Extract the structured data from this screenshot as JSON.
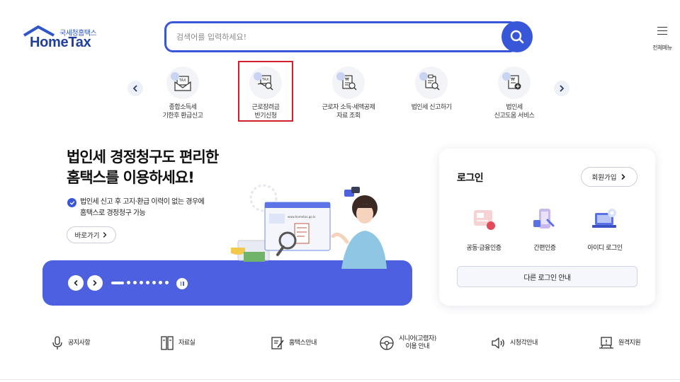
{
  "header": {
    "logo_sub": "국세청홈택스",
    "logo_main": "HomeTax",
    "search_placeholder": "검색어를 입력하세요!",
    "all_menu_label": "전체메뉴"
  },
  "quick_menu": {
    "items": [
      {
        "label": "종합소득세\n기한후 환급신고",
        "icon": "tax-envelope-icon"
      },
      {
        "label": "근로장려금\n반기신청",
        "icon": "tax-hand-search-icon",
        "highlighted": true
      },
      {
        "label": "근로자 소득·세액공제\n자료 조회",
        "icon": "receipt-search-icon"
      },
      {
        "label": "법인세 신고하기",
        "icon": "document-search-icon"
      },
      {
        "label": "법인세\n신고도움 서비스",
        "icon": "tax-document-plus-icon"
      }
    ]
  },
  "banner": {
    "title": "법인세 경정청구도 편리한\n홈택스를 이용하세요!",
    "description": "법인세 신고 후 고지·환급 이력이 없는 경우에\n홈택스로 경정청구 가능",
    "go_button": "바로가기",
    "illustration_url_text": "www.hometax.go.kr",
    "pager_count": 8
  },
  "login": {
    "title": "로그인",
    "join_button": "회원가입",
    "options": [
      {
        "label": "공동·금융인증",
        "icon": "certificate-icon"
      },
      {
        "label": "간편인증",
        "icon": "mobile-auth-icon"
      },
      {
        "label": "아이디 로그인",
        "icon": "laptop-id-icon"
      }
    ],
    "other_login": "다른 로그인 안내"
  },
  "bottom_menu": [
    {
      "label": "공지사항",
      "icon": "microphone-icon"
    },
    {
      "label": "자료실",
      "icon": "archive-icon"
    },
    {
      "label": "홈택스안내",
      "icon": "edit-note-icon"
    },
    {
      "label": "시니어(고령자)\n이용 안내",
      "icon": "steering-wheel-icon"
    },
    {
      "label": "시청각안내",
      "icon": "speaker-icon"
    },
    {
      "label": "원격지원",
      "icon": "remote-support-icon"
    }
  ],
  "colors": {
    "primary": "#3857d8",
    "banner_bar": "#4d61e0",
    "highlight_border": "#d21f2c"
  }
}
